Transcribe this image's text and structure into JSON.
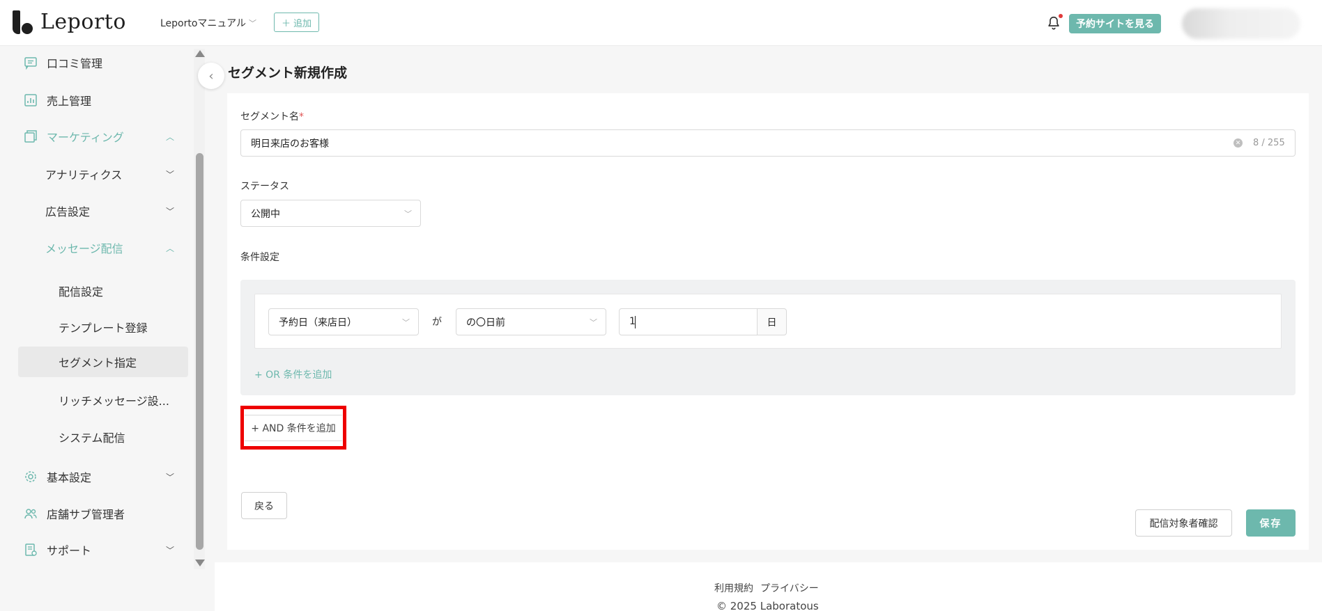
{
  "header": {
    "logo_text": "Leporto",
    "store_name": "Leportoマニュアル",
    "add_label": "追加",
    "view_site_label": "予約サイトを見る",
    "accent_color": "#6db8ad"
  },
  "sidebar": {
    "items": [
      {
        "label": "口コミ管理",
        "icon": "review-icon"
      },
      {
        "label": "売上管理",
        "icon": "sales-chart-icon"
      },
      {
        "label": "マーケティング",
        "icon": "marketing-icon"
      },
      {
        "label": "アナリティクス"
      },
      {
        "label": "広告設定"
      },
      {
        "label": "メッセージ配信"
      },
      {
        "label": "配信設定"
      },
      {
        "label": "テンプレート登録"
      },
      {
        "label": "セグメント指定"
      },
      {
        "label": "リッチメッセージ設..."
      },
      {
        "label": "システム配信"
      },
      {
        "label": "基本設定",
        "icon": "gear-icon"
      },
      {
        "label": "店舗サブ管理者",
        "icon": "users-icon"
      },
      {
        "label": "サポート",
        "icon": "support-icon"
      }
    ]
  },
  "main": {
    "title": "セグメント新規作成",
    "segment_name_label": "セグメント名",
    "required_mark": "*",
    "segment_name_value": "明日来店のお客様",
    "char_count": "8 / 255",
    "status_label": "ステータス",
    "status_value": "公開中",
    "conditions_label": "条件設定",
    "condition": {
      "field": "予約日（来店日）",
      "connector": "が",
      "operator": "の〇日前",
      "value": "1",
      "unit": "日"
    },
    "or_add_label": "+ OR 条件を追加",
    "and_add_label": "+ AND 条件を追加",
    "back_label": "戻る",
    "check_targets_label": "配信対象者確認",
    "save_label": "保存"
  },
  "footer": {
    "terms": "利用規約",
    "privacy": "プライバシー",
    "copyright": "© 2025 Laboratous"
  }
}
